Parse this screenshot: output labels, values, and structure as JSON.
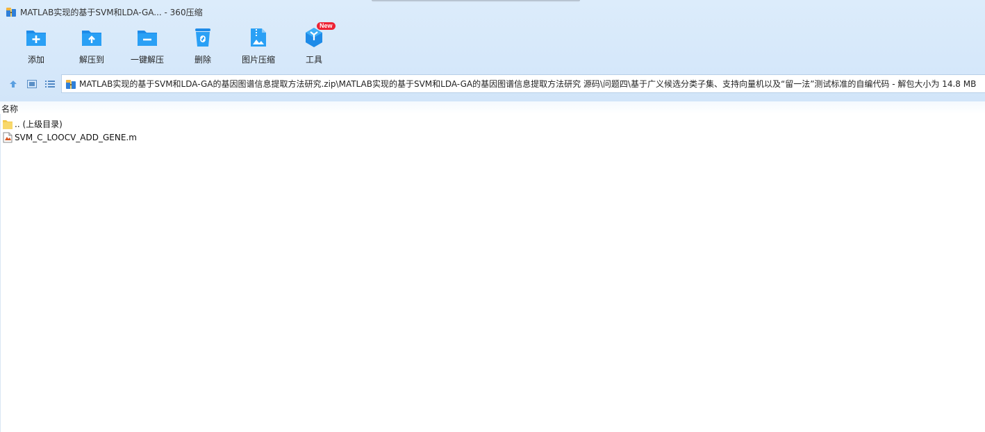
{
  "window": {
    "title": "MATLAB实现的基于SVM和LDA-GA... - 360压缩"
  },
  "toolbar": {
    "items": [
      {
        "label": "添加",
        "icon": "add-folder-icon"
      },
      {
        "label": "解压到",
        "icon": "extract-to-icon"
      },
      {
        "label": "一键解压",
        "icon": "one-click-extract-icon"
      },
      {
        "label": "删除",
        "icon": "delete-bin-icon"
      },
      {
        "label": "图片压缩",
        "icon": "image-compress-icon"
      },
      {
        "label": "工具",
        "icon": "tools-cube-icon",
        "badge": "New"
      }
    ]
  },
  "address": {
    "path": "MATLAB实现的基于SVM和LDA-GA的基因图谱信息提取方法研究.zip\\MATLAB实现的基于SVM和LDA-GA的基因图谱信息提取方法研究 源码\\问题四\\基于广义候选分类子集、支持向量机以及“留一法”测试标准的自编代码 - 解包大小为 14.8 MB"
  },
  "list": {
    "column_name": "名称",
    "rows": [
      {
        "name": ".. (上级目录)",
        "type": "folder"
      },
      {
        "name": "SVM_C_LOOCV_ADD_GENE.m",
        "type": "m-file"
      }
    ]
  },
  "colors": {
    "accent": "#1e90ea",
    "toolbar_bg": "#d8eafb",
    "badge": "#ee2233"
  }
}
